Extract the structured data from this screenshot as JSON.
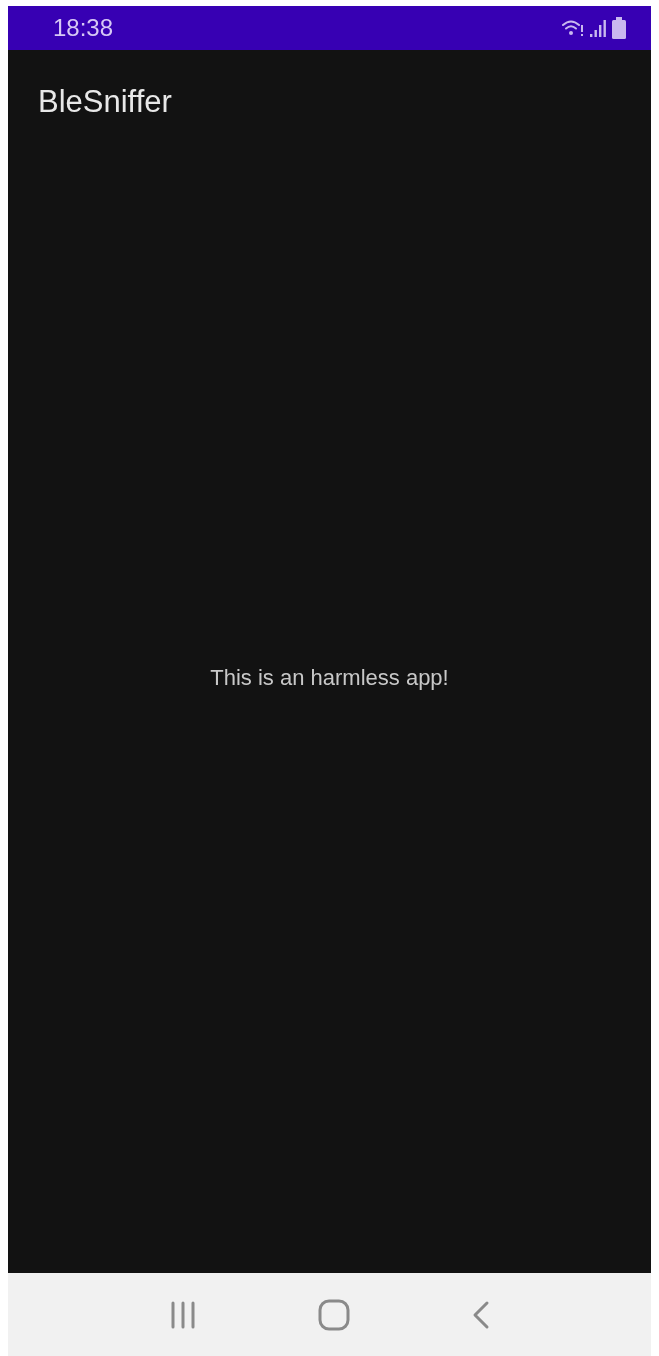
{
  "status_bar": {
    "time": "18:38"
  },
  "app_bar": {
    "title": "BleSniffer"
  },
  "content": {
    "message": "This is an harmless app!"
  }
}
